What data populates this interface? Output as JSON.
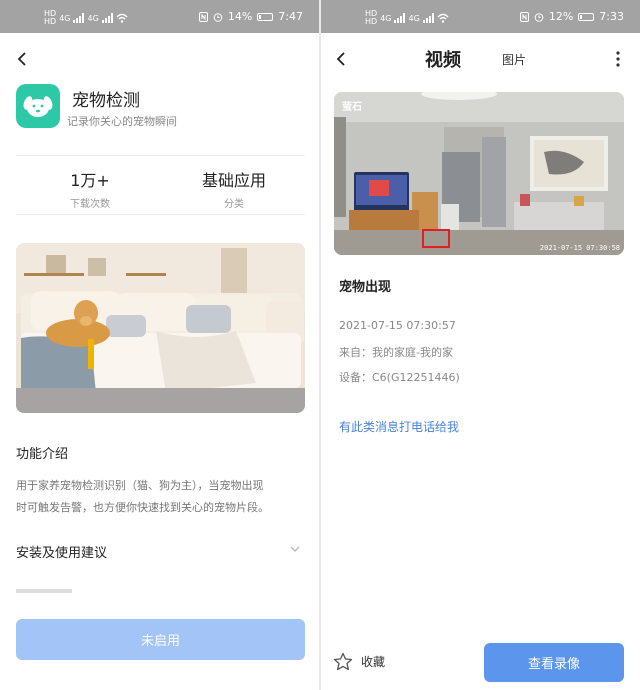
{
  "left": {
    "status": {
      "hd1": "HD",
      "hd2": "HD",
      "sig1": "4G",
      "sig2": "4G",
      "battery": "14%",
      "time": "7:47"
    },
    "app": {
      "title": "宠物检测",
      "subtitle": "记录你关心的宠物瞬间"
    },
    "stats": [
      {
        "value": "1万+",
        "label": "下载次数"
      },
      {
        "value": "基础应用",
        "label": "分类"
      }
    ],
    "feature": {
      "title": "功能介绍",
      "desc_line1": "用于家养宠物检测识别（猫、狗为主），当宠物出现",
      "desc_line2": "时可触发告警，也方便你快速找到关心的宠物片段。"
    },
    "install_title": "安装及使用建议",
    "enable_button": "未启用"
  },
  "right": {
    "status": {
      "hd1": "HD",
      "hd2": "HD",
      "sig1": "4G",
      "sig2": "4G",
      "battery": "12%",
      "time": "7:33"
    },
    "tabs": {
      "video": "视频",
      "image": "图片"
    },
    "camera": {
      "brand": "萤石",
      "timestamp": "2021-07-15 07:30:58"
    },
    "event": {
      "title": "宠物出现",
      "datetime": "2021-07-15 07:30:57",
      "source": "来自：我的家庭-我的家",
      "device": "设备：C6(G12251446)"
    },
    "call_link": "有此类消息打电话给我",
    "favorite_label": "收藏",
    "view_button": "查看录像"
  },
  "colors": {
    "accent": "#5b95ec",
    "disabled": "#a3c4f7",
    "app_icon": "#2dc9a7",
    "link": "#4a83d8"
  }
}
